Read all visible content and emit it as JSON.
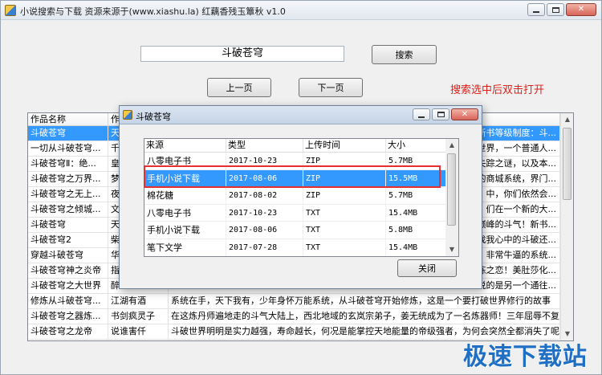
{
  "window": {
    "title": "小说搜索与下载   资源来源于(www.xiashu.la)   红藕香残玉簟秋   v1.0",
    "minimize_label": "",
    "maximize_label": "",
    "close_label": "✕"
  },
  "search": {
    "value": "斗破苍穹",
    "button_label": "搜索"
  },
  "pager": {
    "prev_label": "上一页",
    "next_label": "下一页"
  },
  "hint": "搜索选中后双击打开",
  "grid": {
    "columns": [
      "作品名称",
      "作",
      ""
    ],
    "rows": [
      {
        "name": "斗破苍穹",
        "author": "天",
        "desc": "新书等级制度：斗...",
        "selected": true
      },
      {
        "name": "一切从斗破苍穹...",
        "author": "千",
        "desc": "世界，一个普通人..."
      },
      {
        "name": "斗破苍穹Ⅱ：绝...",
        "author": "皇",
        "desc": "失踪之谜，以及本..."
      },
      {
        "name": "斗破苍穹之万界...",
        "author": "梦",
        "desc": "的商城系统，界门..."
      },
      {
        "name": "斗破苍穹之无上...",
        "author": "夜",
        "desc": "中，你们依然会..."
      },
      {
        "name": "斗破苍穹之倾城...",
        "author": "文",
        "desc": "们在一个新的大..."
      },
      {
        "name": "斗破苍穹",
        "author": "天",
        "desc": "巅峰的斗气！新书..."
      },
      {
        "name": "斗破苍穹2",
        "author": "柴",
        "desc": "找我心中的斗破还..."
      },
      {
        "name": "穿越斗破苍穹",
        "author": "华",
        "desc": "非常牛逼的系统..."
      },
      {
        "name": "斗破苍穹神之炎帝",
        "author": "指",
        "desc": "炼之恋！美肚莎化..."
      },
      {
        "name": "斗破苍穹之大世界",
        "author": "醉",
        "desc": "说的是另一个通往..."
      },
      {
        "name": "修炼从斗破苍穹...",
        "author": "江湖有酒",
        "desc": "系统在手，天下我有，少年身怀万能系统，从斗破苍穹开始修炼，这是一个要打破世界修行的故事",
        "full": true
      },
      {
        "name": "斗破苍穹之器炼...",
        "author": "书剑疯灵子",
        "desc": "在这炼丹师遍地走的斗气大陆上，西北地域的玄岚宗弟子，姜无统成为了一名炼器师！三年屈辱不复...",
        "full": true
      },
      {
        "name": "斗破苍穹之龙帝",
        "author": "说谁害仟",
        "desc": "斗破世界明明是实力越强，寿命越长，何况是能掌控天地能量的帝级强者，为何会突然全都消失了呢...",
        "full": true
      }
    ]
  },
  "dialog": {
    "title": "斗破苍穹",
    "columns": [
      "来源",
      "类型",
      "上传时间",
      "大小"
    ],
    "rows": [
      {
        "source": "八零电子书",
        "date": "2017-10-23",
        "type": "ZIP",
        "size": "5.7MB"
      },
      {
        "source": "手机小说下载",
        "date": "2017-08-06",
        "type": "ZIP",
        "size": "15.5MB",
        "selected": true
      },
      {
        "source": "棉花糖",
        "date": "2017-08-02",
        "type": "ZIP",
        "size": "5.7MB"
      },
      {
        "source": "八零电子书",
        "date": "2017-10-23",
        "type": "TXT",
        "size": "15.4MB"
      },
      {
        "source": "手机小说下载",
        "date": "2017-08-06",
        "type": "TXT",
        "size": "5.8MB"
      },
      {
        "source": "笔下文学",
        "date": "2017-07-28",
        "type": "TXT",
        "size": "15.4MB"
      }
    ],
    "close_label": "关闭"
  },
  "watermark": "极速下载站",
  "colors": {
    "selection": "#3399ff",
    "hint": "#e0201a",
    "highlight_box": "#e53030",
    "watermark": "#1f6fc4"
  }
}
